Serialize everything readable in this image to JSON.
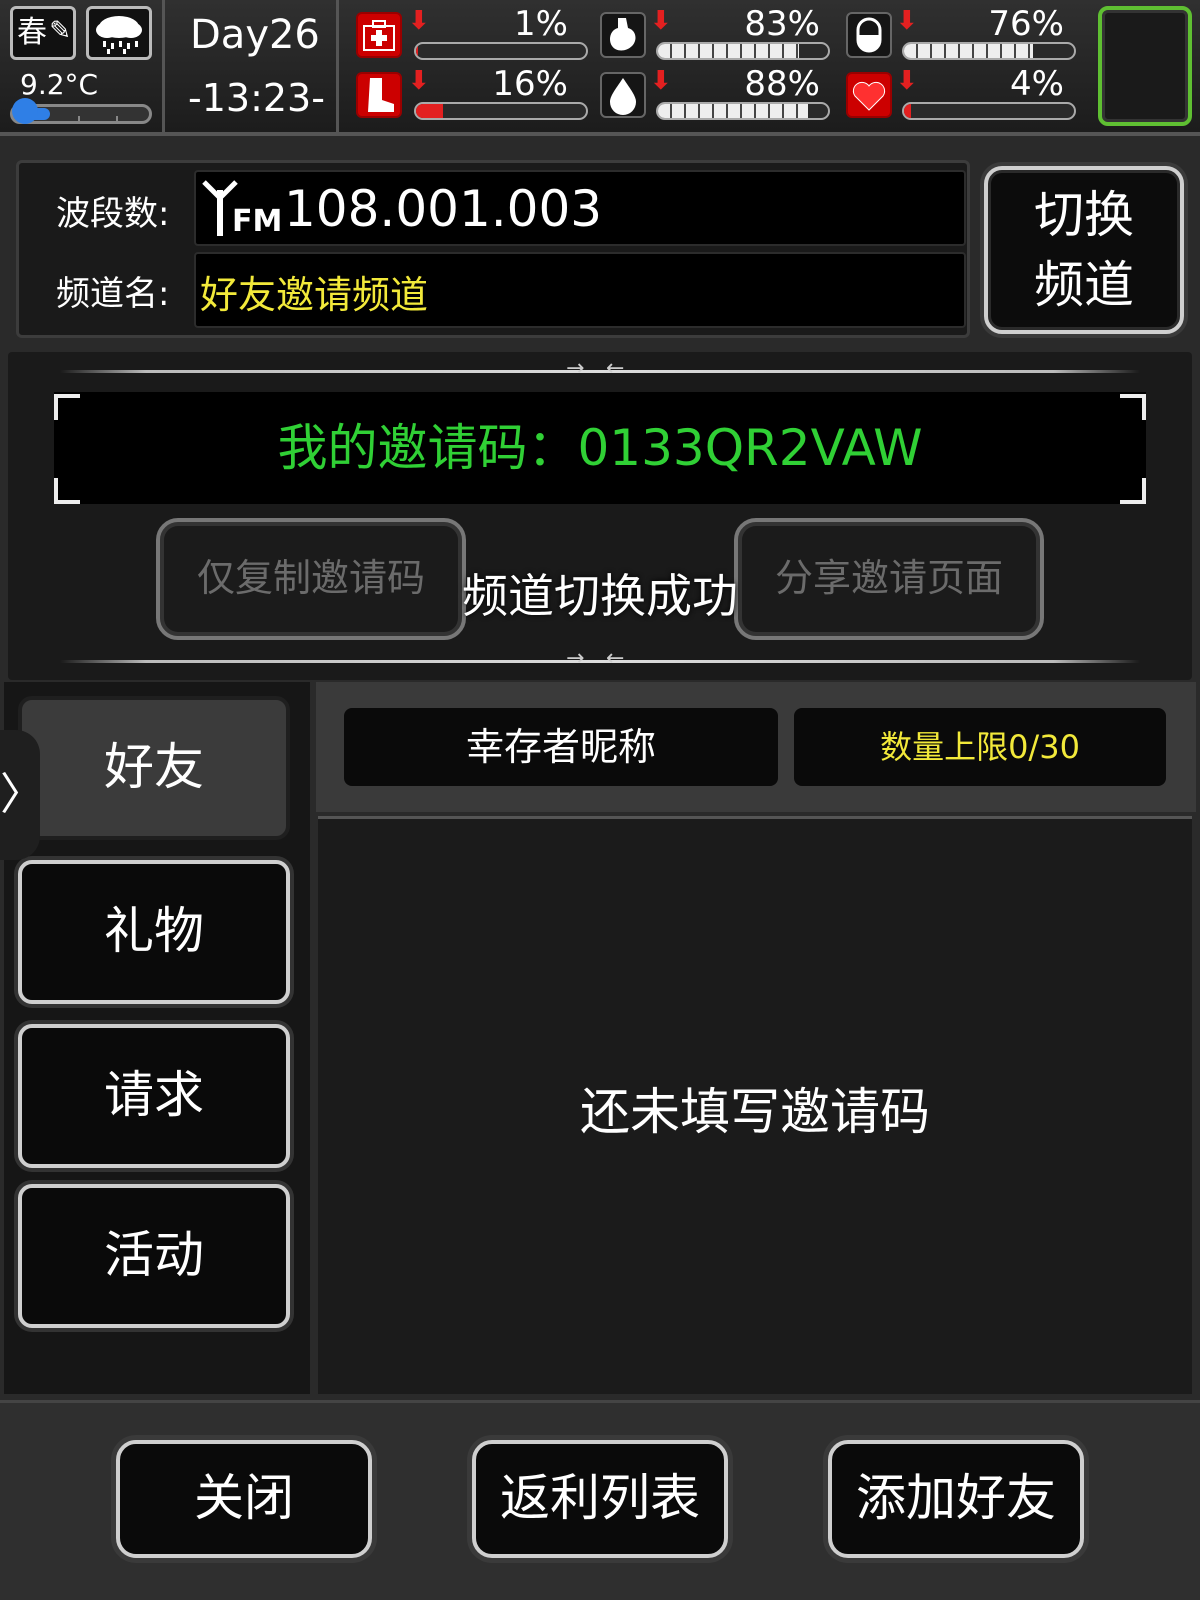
{
  "hud": {
    "season": "春",
    "weather_icon": "rain-cloud-icon",
    "temperature": "9.2°C",
    "day": "Day26",
    "time": "-13:23-",
    "stats": [
      {
        "name": "health",
        "icon": "medkit-icon",
        "percent_label": "1%",
        "value": 1,
        "trend": "down"
      },
      {
        "name": "hunger",
        "icon": "stomach-icon",
        "percent_label": "83%",
        "value": 83,
        "trend": "down"
      },
      {
        "name": "medicine",
        "icon": "pill-icon",
        "percent_label": "76%",
        "value": 76,
        "trend": "down"
      },
      {
        "name": "stamina",
        "icon": "boot-icon",
        "percent_label": "16%",
        "value": 16,
        "trend": "down"
      },
      {
        "name": "thirst",
        "icon": "water-drop-icon",
        "percent_label": "88%",
        "value": 88,
        "trend": "down"
      },
      {
        "name": "mood",
        "icon": "heart-icon",
        "percent_label": "4%",
        "value": 4,
        "trend": "down"
      }
    ]
  },
  "radio": {
    "band_label": "波段数:",
    "fm_prefix": "FM",
    "frequency": "108.001.003",
    "channel_label": "频道名:",
    "channel_name": "好友邀请频道",
    "switch_line1": "切换",
    "switch_line2": "频道"
  },
  "invite": {
    "code_text": "我的邀请码：0133QR2VAW",
    "copy_button": "仅复制邀请码",
    "share_button": "分享邀请页面",
    "toast": "频道切换成功"
  },
  "tabs": [
    {
      "label": "好友",
      "active": true
    },
    {
      "label": "礼物",
      "active": false
    },
    {
      "label": "请求",
      "active": false
    },
    {
      "label": "活动",
      "active": false
    }
  ],
  "friends": {
    "nickname_header": "幸存者昵称",
    "limit_header": "数量上限0/30",
    "empty_text": "还未填写邀请码"
  },
  "footer": {
    "close": "关闭",
    "rebate_list": "返利列表",
    "add_friend": "添加好友"
  },
  "colors": {
    "invite_code": "#30d035",
    "channel_name": "#f2e93a",
    "limit_text": "#f2e93a",
    "alert_red": "#e32020",
    "status_green": "#5fbf32"
  }
}
